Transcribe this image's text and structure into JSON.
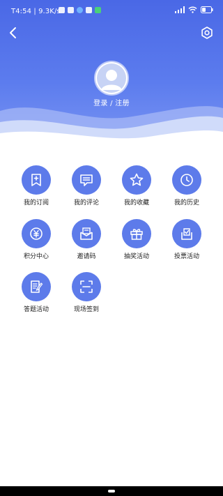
{
  "status_bar": {
    "time": "T4:54 | 9.3K/s"
  },
  "profile": {
    "login_text": "登录 / 注册"
  },
  "menu": [
    {
      "label": "我的订阅",
      "icon": "bookmark-plus-icon"
    },
    {
      "label": "我的评论",
      "icon": "comment-icon"
    },
    {
      "label": "我的收藏",
      "icon": "star-icon"
    },
    {
      "label": "我的历史",
      "icon": "clock-icon"
    },
    {
      "label": "积分中心",
      "icon": "yen-coin-icon"
    },
    {
      "label": "邀请码",
      "icon": "invite-envelope-icon"
    },
    {
      "label": "抽奖活动",
      "icon": "gift-icon"
    },
    {
      "label": "投票活动",
      "icon": "ballot-box-icon"
    },
    {
      "label": "答题活动",
      "icon": "quiz-pen-icon"
    },
    {
      "label": "现场签到",
      "icon": "scan-frame-icon"
    }
  ],
  "colors": {
    "accent": "#5d7bea",
    "header_top": "#4a68e6"
  }
}
